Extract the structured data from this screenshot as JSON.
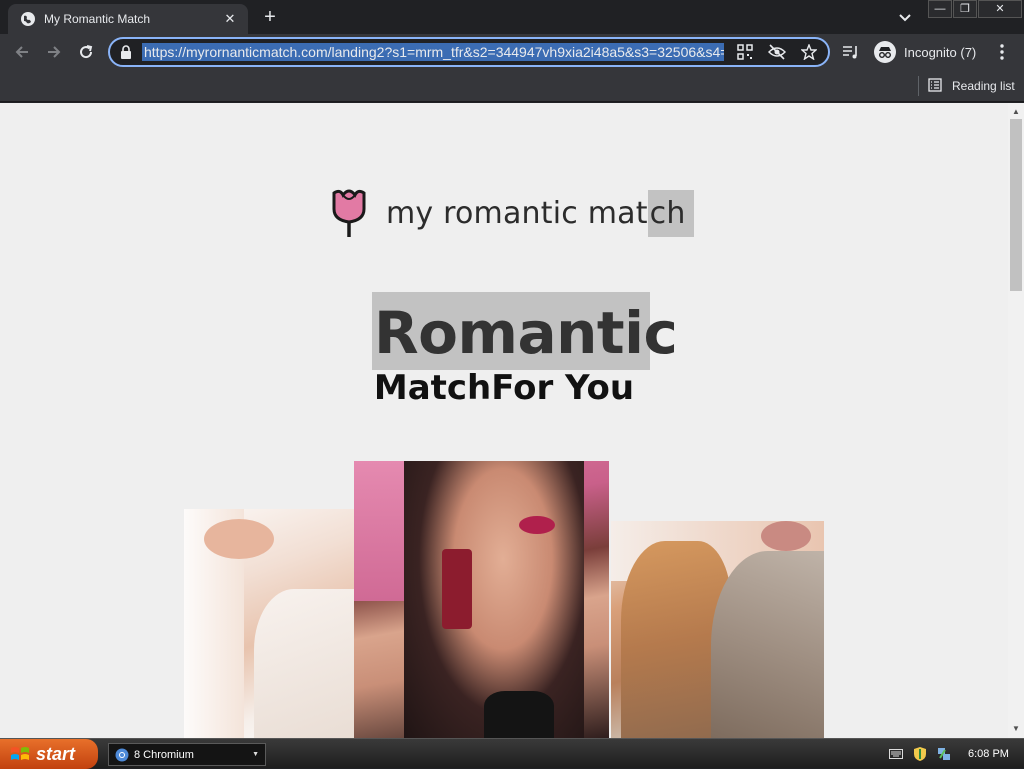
{
  "browser": {
    "tab_title": "My Romantic Match",
    "tab_close": "✕",
    "new_tab": "+",
    "window_buttons": {
      "minimize": "—",
      "maximize": "❐",
      "close": "✕"
    },
    "url": "https://myrornanticmatch.com/landing2?s1=mrm_tfr&s2=344947vh9xia2i48a5&s3=32506&s4=",
    "incognito_label": "Incognito (7)",
    "reading_list_label": "Reading list"
  },
  "page": {
    "brand_prefix": "my romantic mat",
    "brand_highlight": "ch",
    "headline_primary": "Romantic",
    "headline_secondary": "MatchFor You",
    "photos": [
      "photo-woman-white-dress",
      "photo-woman-red-earring",
      "photo-woman-curly-hair"
    ]
  },
  "taskbar": {
    "start_label": "start",
    "task_label": "8 Chromium",
    "clock": "6:08 PM"
  },
  "colors": {
    "accent_focus": "#8ab4f8",
    "page_background": "#efefef",
    "logo_rose": "#e27aa4",
    "highlight": "#c2c2c2"
  }
}
